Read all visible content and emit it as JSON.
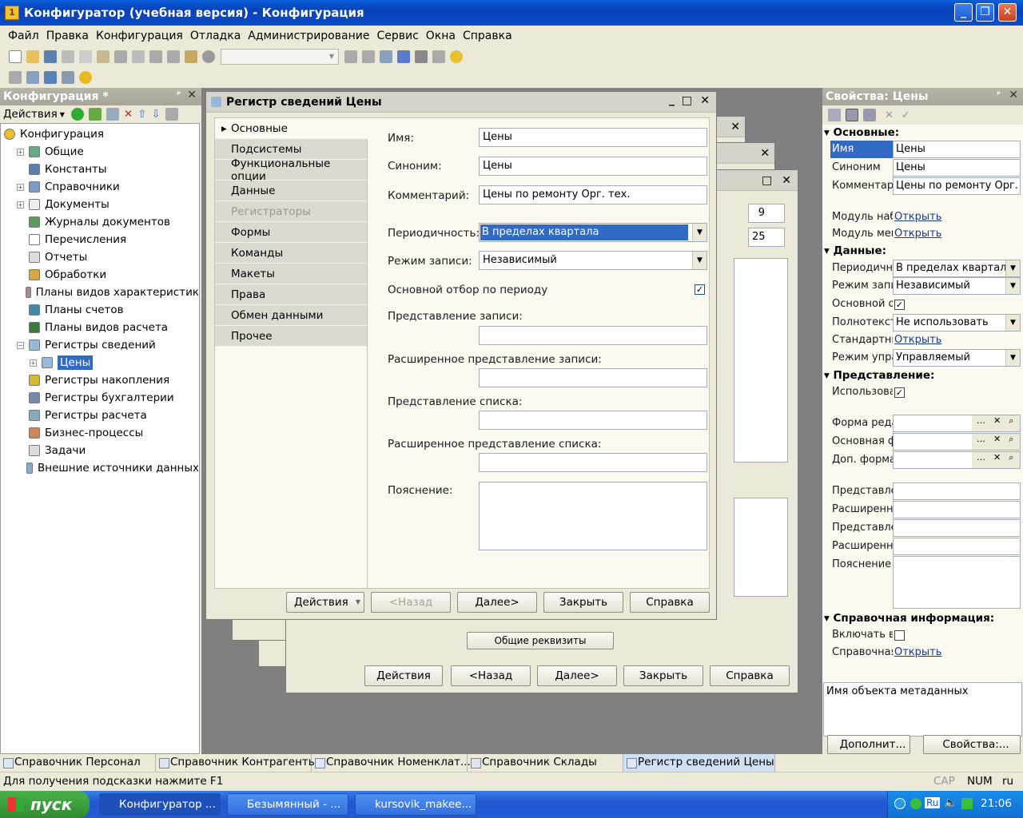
{
  "window": {
    "title": "Конфигуратор (учебная версия) - Конфигурация"
  },
  "menu": [
    "Файл",
    "Правка",
    "Конфигурация",
    "Отладка",
    "Администрирование",
    "Сервис",
    "Окна",
    "Справка"
  ],
  "config_panel": {
    "title": "Конфигурация *",
    "actions": "Действия",
    "tree": [
      {
        "label": "Конфигурация",
        "level": 0,
        "icon": "config-icon"
      },
      {
        "label": "Общие",
        "level": 1,
        "icon": "common-icon",
        "exp": "+"
      },
      {
        "label": "Константы",
        "level": 1,
        "icon": "constants-icon"
      },
      {
        "label": "Справочники",
        "level": 1,
        "icon": "catalogs-icon",
        "exp": "+"
      },
      {
        "label": "Документы",
        "level": 1,
        "icon": "documents-icon",
        "exp": "+"
      },
      {
        "label": "Журналы документов",
        "level": 1,
        "icon": "journals-icon"
      },
      {
        "label": "Перечисления",
        "level": 1,
        "icon": "enums-icon"
      },
      {
        "label": "Отчеты",
        "level": 1,
        "icon": "reports-icon"
      },
      {
        "label": "Обработки",
        "level": 1,
        "icon": "processing-icon"
      },
      {
        "label": "Планы видов характеристик",
        "level": 1,
        "icon": "chart-types-icon"
      },
      {
        "label": "Планы счетов",
        "level": 1,
        "icon": "accounts-icon"
      },
      {
        "label": "Планы видов расчета",
        "level": 1,
        "icon": "calc-types-icon"
      },
      {
        "label": "Регистры сведений",
        "level": 1,
        "icon": "info-registers-icon",
        "exp": "−"
      },
      {
        "label": "Цены",
        "level": 2,
        "icon": "register-icon",
        "exp": "+",
        "selected": true
      },
      {
        "label": "Регистры накопления",
        "level": 1,
        "icon": "accum-registers-icon"
      },
      {
        "label": "Регистры бухгалтерии",
        "level": 1,
        "icon": "acc-registers-icon"
      },
      {
        "label": "Регистры расчета",
        "level": 1,
        "icon": "calc-registers-icon"
      },
      {
        "label": "Бизнес-процессы",
        "level": 1,
        "icon": "bp-icon"
      },
      {
        "label": "Задачи",
        "level": 1,
        "icon": "tasks-icon"
      },
      {
        "label": "Внешние источники данных",
        "level": 1,
        "icon": "ext-sources-icon"
      }
    ]
  },
  "dialog": {
    "title": "Регистр сведений Цены",
    "nav": [
      "Основные",
      "Подсистемы",
      "Функциональные опции",
      "Данные",
      "Регистраторы",
      "Формы",
      "Команды",
      "Макеты",
      "Права",
      "Обмен данными",
      "Прочее"
    ],
    "fields": {
      "name_label": "Имя:",
      "name_value": "Цены",
      "synonym_label": "Синоним:",
      "synonym_value": "Цены",
      "comment_label": "Комментарий:",
      "comment_value": "Цены по ремонту Орг. тех.",
      "periodicity_label": "Периодичность:",
      "periodicity_value": "В пределах квартала",
      "write_mode_label": "Режим записи:",
      "write_mode_value": "Независимый",
      "main_filter_label": "Основной отбор по периоду",
      "record_repr_label": "Представление записи:",
      "ext_record_repr_label": "Расширенное представление записи:",
      "list_repr_label": "Представление списка:",
      "ext_list_repr_label": "Расширенное представление списка:",
      "explanation_label": "Пояснение:"
    },
    "buttons": {
      "actions": "Действия",
      "back": "<Назад",
      "next": "Далее>",
      "close": "Закрыть",
      "help": "Справка"
    }
  },
  "bg_dialogs": {
    "actions": "Действия",
    "back": "<Назад",
    "next": "Далее>",
    "close": "Закрыть",
    "help": "Справка",
    "spin1": "9",
    "spin2": "25",
    "common_props": "Общие реквизиты"
  },
  "props_panel": {
    "title": "Свойства: Цены",
    "s_main": "Основные:",
    "name_label": "Имя",
    "name_value": "Цены",
    "synonym_label": "Синоним",
    "synonym_value": "Цены",
    "comment_label": "Комментарий",
    "comment_value": "Цены по ремонту Орг. те",
    "module1_label": "Модуль набора записей",
    "module2_label": "Модуль менеджера",
    "open": "Открыть",
    "s_data": "Данные:",
    "period_label": "Периодичность",
    "period_value": "В пределах квартала",
    "mode_label": "Режим записи",
    "mode_value": "Независимый",
    "mainfilter_label": "Основной отбор",
    "fulltext_label": "Полнотекстовый поиск",
    "fulltext_value": "Не использовать",
    "standard_label": "Стандартные реквизиты",
    "manage_label": "Режим управления",
    "manage_value": "Управляемый",
    "s_repr": "Представление:",
    "use_label": "Использовать",
    "form1_label": "Форма редактирования",
    "form2_label": "Основная форма",
    "form3_label": "Доп. форма",
    "repr1": "Представление",
    "repr2": "Расширенное",
    "repr3": "Представление",
    "repr4": "Расширенное",
    "expl": "Пояснение",
    "s_help": "Справочная информация:",
    "include_label": "Включать в справку",
    "helpinfo_label": "Справочная",
    "description": "Имя объекта метаданных",
    "extra_btn": "Дополнит...",
    "props_btn": "Свойства:..."
  },
  "window_list": [
    "Справочник Персонал",
    "Справочник Контрагенты",
    "Справочник Номенклат...",
    "Справочник Склады",
    "Регистр сведений Цены"
  ],
  "status": {
    "hint": "Для получения подсказки нажмите F1",
    "cap": "CAP",
    "num": "NUM",
    "lang": "ru"
  },
  "taskbar": {
    "start": "пуск",
    "tasks": [
      "Конфигуратор ...",
      "Безымянный - ...",
      "kursovik_makee..."
    ],
    "lang": "Ru",
    "time": "21:06"
  },
  "colors": {
    "selection": "#316ac5",
    "xp_blue": "#0a5fd8",
    "face": "#ece9d8"
  }
}
